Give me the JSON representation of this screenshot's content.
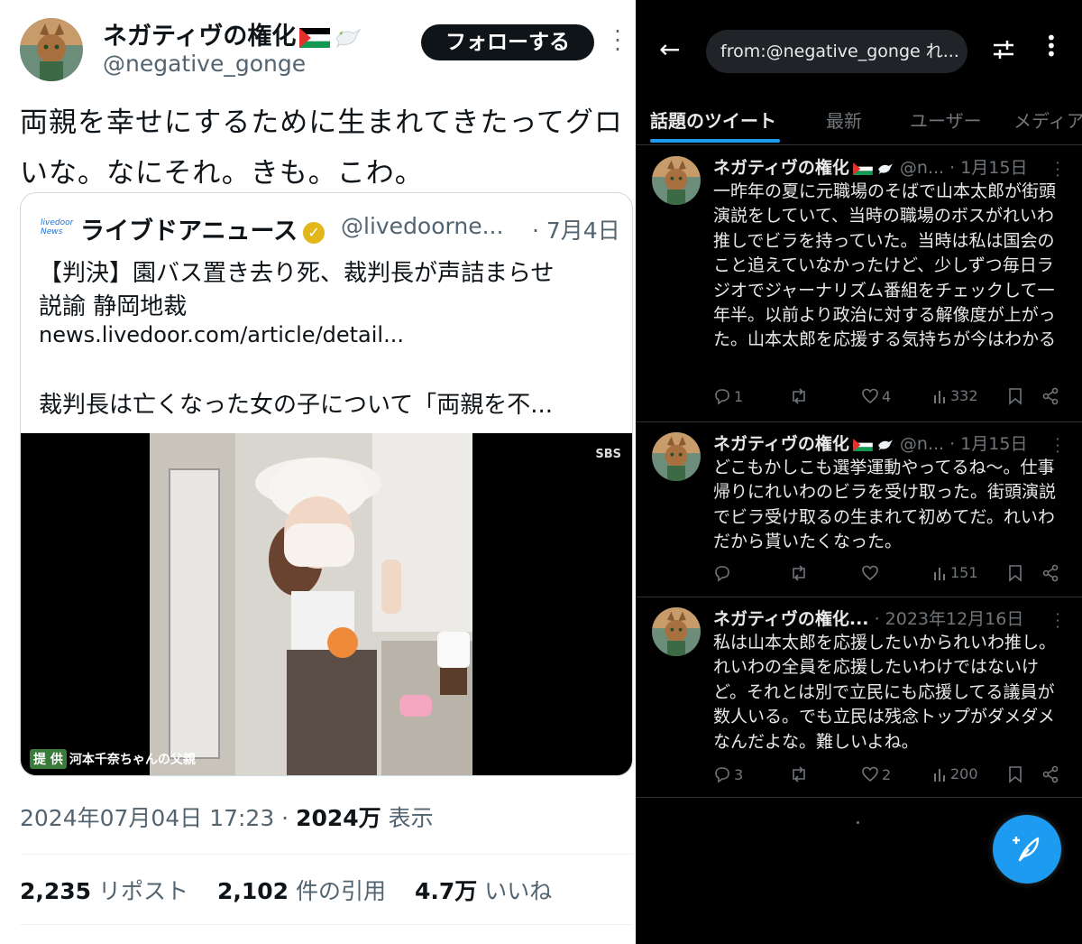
{
  "left": {
    "author_name": "ネガティヴの権化",
    "author_handle": "@negative_gonge",
    "follow_label": "フォローする",
    "tweet_text": "両親を幸せにするために生まれてきたってグロいな。なにそれ。きも。こわ。",
    "quote": {
      "logo_text": "livedoor News",
      "name": "ライブドアニュース",
      "handle": "@livedoorne...",
      "date": "· 7月4日",
      "line1": "【判決】園バス置き去り死、裁判長が声詰まらせ",
      "line2": "説諭 静岡地裁",
      "link": "news.livedoor.com/article/detail...",
      "line3": "裁判長は亡くなった女の子について「両親を不...",
      "media_watermark": "SBS",
      "media_credit_tag": "提 供",
      "media_credit": "河本千奈ちゃんの父親"
    },
    "timestamp": "2024年07月04日 17:23 · ",
    "views_count": "2024万",
    "views_label": " 表示",
    "reposts_count": "2,235",
    "reposts_label": " リポスト",
    "quotes_count": "2,102",
    "quotes_label": " 件の引用",
    "likes_count": "4.7万",
    "likes_label": " いいね"
  },
  "right": {
    "search_query": "from:@negative_gonge れ...",
    "tabs": [
      "話題のツイート",
      "最新",
      "ユーザー",
      "メディア"
    ],
    "tweets": [
      {
        "name": "ネガティヴの権化",
        "handle": "@n...",
        "date": "· 1月15日",
        "text": "一昨年の夏に元職場のそばで山本太郎が街頭演説をしていて、当時の職場のボスがれいわ推しでビラを持っていた。当時は私は国会のこと追えていなかったけど、少しずつ毎日ラジオでジャーナリズム番組をチェックして一年半。以前より政治に対する解像度が上がった。山本太郎を応援する気持ちが今はわかる",
        "replies": "1",
        "retweets": "",
        "likes": "4",
        "views": "332"
      },
      {
        "name": "ネガティヴの権化",
        "handle": "@n...",
        "date": "· 1月15日",
        "text": "どこもかしこも選挙運動やってるね〜。仕事帰りにれいわのビラを受け取った。街頭演説でビラ受け取るの生まれて初めてだ。れいわだから貰いたくなった。",
        "replies": "",
        "retweets": "",
        "likes": "",
        "views": "151"
      },
      {
        "name": "ネガティヴの権化...",
        "handle": "",
        "date": "· 2023年12月16日",
        "text": "私は山本太郎を応援したいかられいわ推し。れいわの全員を応援したいわけではないけど。それとは別で立民にも応援してる議員が数人いる。でも立民は残念トップがダメダメなんだよな。難しいよね。",
        "replies": "3",
        "retweets": "",
        "likes": "2",
        "views": "200"
      }
    ]
  },
  "colors": {
    "accent": "#1d9bf0",
    "dark_bg": "#000000",
    "muted": "#71767b",
    "verified_gold": "#e2b719"
  }
}
